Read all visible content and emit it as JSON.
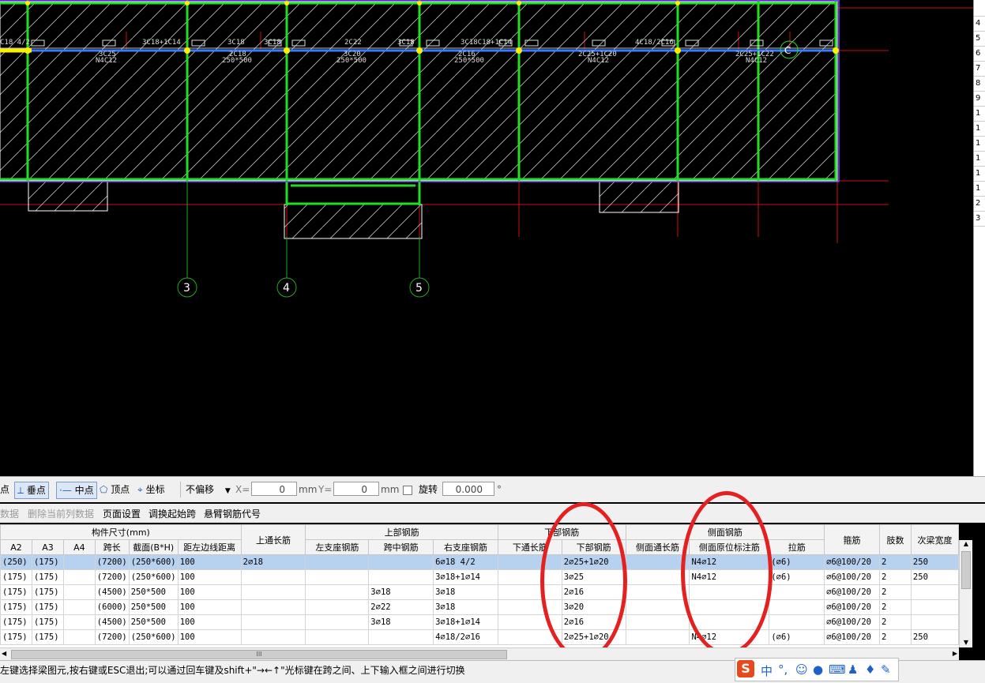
{
  "cad": {
    "grid_axes": [
      "3",
      "4",
      "5"
    ],
    "axis_c_label": "C",
    "beam_labels": [
      {
        "text": "C18 4/2"
      },
      {
        "text": "3C18+1C14"
      },
      {
        "text": "3C18"
      },
      {
        "text": "3C18"
      },
      {
        "text": "2C22"
      },
      {
        "text": "3C18"
      },
      {
        "text": "3C18C18+1C14"
      },
      {
        "text": "4C18/2C16"
      },
      {
        "text": "3C25"
      },
      {
        "text": "N4C12"
      },
      {
        "text": "2C18"
      },
      {
        "text": "250*500"
      },
      {
        "text": "3C20"
      },
      {
        "text": "250*500"
      },
      {
        "text": "2C16"
      },
      {
        "text": "250*500"
      },
      {
        "text": "2C25+1C20"
      },
      {
        "text": "N4C12"
      },
      {
        "text": "2C25+1C22"
      },
      {
        "text": "N4C12"
      }
    ],
    "colors": {
      "beam_green": "#22dd22",
      "axis_blue": "#3a7bff",
      "grid_red": "#cc1111",
      "purple_line": "#7a3cff",
      "annotation_red": "#e52020"
    }
  },
  "right_panel": {
    "rows": [
      "4",
      "5",
      "6",
      "7",
      "8",
      "9",
      "1",
      "1",
      "1",
      "1",
      "1",
      "1",
      "2",
      "3"
    ]
  },
  "snap_toolbar": {
    "endpoint_label": "点",
    "perpendicular_label": "垂点",
    "midpoint_label": "中点",
    "vertex_label": "顶点",
    "coord_label": "坐标",
    "offset_mode": "不偏移",
    "x_label": "X=",
    "x_value": "0",
    "x_unit": "mm",
    "y_label": "Y=",
    "y_value": "0",
    "y_unit": "mm",
    "rotate_label": "旋转",
    "rotate_value": "0.000",
    "degree": "°"
  },
  "table_toolbar": {
    "items": [
      {
        "label": "数据",
        "enabled": false
      },
      {
        "label": "删除当前列数据",
        "enabled": false
      },
      {
        "label": "页面设置",
        "enabled": true
      },
      {
        "label": "调换起始跨",
        "enabled": true
      },
      {
        "label": "悬臂钢筋代号",
        "enabled": true
      }
    ]
  },
  "table": {
    "group_headers": {
      "dims": "构件尺寸(mm)",
      "top_long": "上通长筋",
      "top_rebar": "上部钢筋",
      "bottom_rebar": "下部钢筋",
      "side_rebar": "侧面钢筋",
      "stirrup": "箍筋",
      "legs": "肢数",
      "sec_width": "次梁宽度"
    },
    "columns": [
      "A2",
      "A3",
      "A4",
      "跨长",
      "截面(B*H)",
      "距左边线距离",
      "左支座钢筋",
      "跨中钢筋",
      "右支座钢筋",
      "下通长筋",
      "下部钢筋",
      "侧面通长筋",
      "侧面原位标注筋",
      "拉筋"
    ],
    "rows": [
      {
        "a2": "(250)",
        "a3": "(175)",
        "a4": "",
        "span": "(7200)",
        "section": "(250*600)",
        "dist": "100",
        "top_long": "2⌀18",
        "left": "",
        "mid": "",
        "right": "6⌀18 4/2",
        "bot_long": "",
        "bottom": "2⌀25+1⌀20",
        "side_long": "",
        "side": "N4⌀12",
        "tie": "(⌀6)",
        "stirrup": "⌀6@100/20",
        "legs": "2",
        "sec": "250",
        "selected": true
      },
      {
        "a2": "(175)",
        "a3": "(175)",
        "a4": "",
        "span": "(7200)",
        "section": "(250*600)",
        "dist": "100",
        "top_long": "",
        "left": "",
        "mid": "",
        "right": "3⌀18+1⌀14",
        "bot_long": "",
        "bottom": "3⌀25",
        "side_long": "",
        "side": "N4⌀12",
        "tie": "(⌀6)",
        "stirrup": "⌀6@100/20",
        "legs": "2",
        "sec": "250",
        "selected": false
      },
      {
        "a2": "(175)",
        "a3": "(175)",
        "a4": "",
        "span": "(4500)",
        "section": "250*500",
        "dist": "100",
        "top_long": "",
        "left": "",
        "mid": "3⌀18",
        "right": "3⌀18",
        "bot_long": "",
        "bottom": "2⌀16",
        "side_long": "",
        "side": "",
        "tie": "",
        "stirrup": "⌀6@100/20",
        "legs": "2",
        "sec": "",
        "selected": false
      },
      {
        "a2": "(175)",
        "a3": "(175)",
        "a4": "",
        "span": "(6000)",
        "section": "250*500",
        "dist": "100",
        "top_long": "",
        "left": "",
        "mid": "2⌀22",
        "right": "3⌀18",
        "bot_long": "",
        "bottom": "3⌀20",
        "side_long": "",
        "side": "",
        "tie": "",
        "stirrup": "⌀6@100/20",
        "legs": "2",
        "sec": "",
        "selected": false
      },
      {
        "a2": "(175)",
        "a3": "(175)",
        "a4": "",
        "span": "(4500)",
        "section": "250*500",
        "dist": "100",
        "top_long": "",
        "left": "",
        "mid": "3⌀18",
        "right": "3⌀18+1⌀14",
        "bot_long": "",
        "bottom": "2⌀16",
        "side_long": "",
        "side": "",
        "tie": "",
        "stirrup": "⌀6@100/20",
        "legs": "2",
        "sec": "",
        "selected": false
      },
      {
        "a2": "(175)",
        "a3": "(175)",
        "a4": "",
        "span": "(7200)",
        "section": "(250*600)",
        "dist": "100",
        "top_long": "",
        "left": "",
        "mid": "",
        "right": "4⌀18/2⌀16",
        "bot_long": "",
        "bottom": "2⌀25+1⌀20",
        "side_long": "",
        "side": "N4⌀12",
        "tie": "(⌀6)",
        "stirrup": "⌀6@100/20",
        "legs": "2",
        "sec": "250",
        "selected": false
      }
    ]
  },
  "hscroll_grip": "III",
  "status_text": "左键选择梁图元,按右键或ESC退出;可以通过回车键及shift+\"→←↑\"光标键在跨之间、上下输入框之间进行切换",
  "ime": {
    "logo": "S",
    "mode": "中",
    "punct": "°,",
    "icons": [
      "smiley-icon",
      "mic-icon",
      "keyboard-icon",
      "user-icon",
      "shirt-icon",
      "wrench-icon"
    ]
  }
}
